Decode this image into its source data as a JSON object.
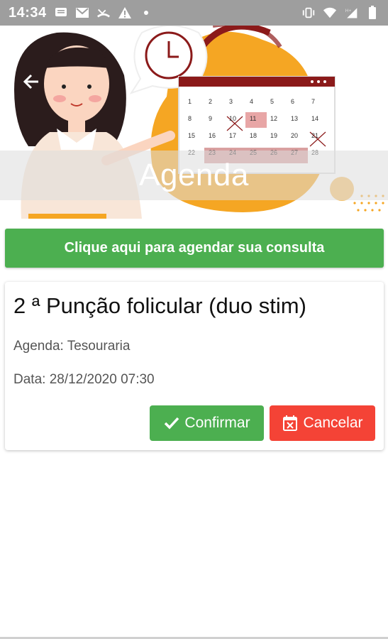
{
  "status_bar": {
    "time": "14:34",
    "left_icons": [
      "message-icon",
      "gmail-icon",
      "missed-call-icon",
      "warning-icon",
      "dot-icon"
    ],
    "right_icons": [
      "vibrate-icon",
      "wifi-icon",
      "signal-h-plus-icon",
      "battery-icon"
    ]
  },
  "header": {
    "title": "Agenda",
    "back_icon": "arrow-left-icon",
    "calendar_days": [
      "1",
      "2",
      "3",
      "4",
      "5",
      "6",
      "7",
      "8",
      "9",
      "10",
      "11",
      "12",
      "13",
      "14",
      "15",
      "16",
      "17",
      "18",
      "19",
      "20",
      "21",
      "22",
      "23",
      "24",
      "25",
      "26",
      "27",
      "28"
    ]
  },
  "schedule_button": {
    "label": "Clique aqui para agendar sua consulta"
  },
  "appointment": {
    "procedure": "2 ª Punção folicular (duo stim)",
    "agenda": "Agenda: Tesouraria",
    "date": "Data: 28/12/2020 07:30",
    "confirm_label": "Confirmar",
    "cancel_label": "Cancelar"
  },
  "colors": {
    "green": "#4caf50",
    "red": "#f44336",
    "status_bar": "#9e9e9e",
    "banner_orange": "#f5a623",
    "calendar_red": "#8b1a1a"
  }
}
